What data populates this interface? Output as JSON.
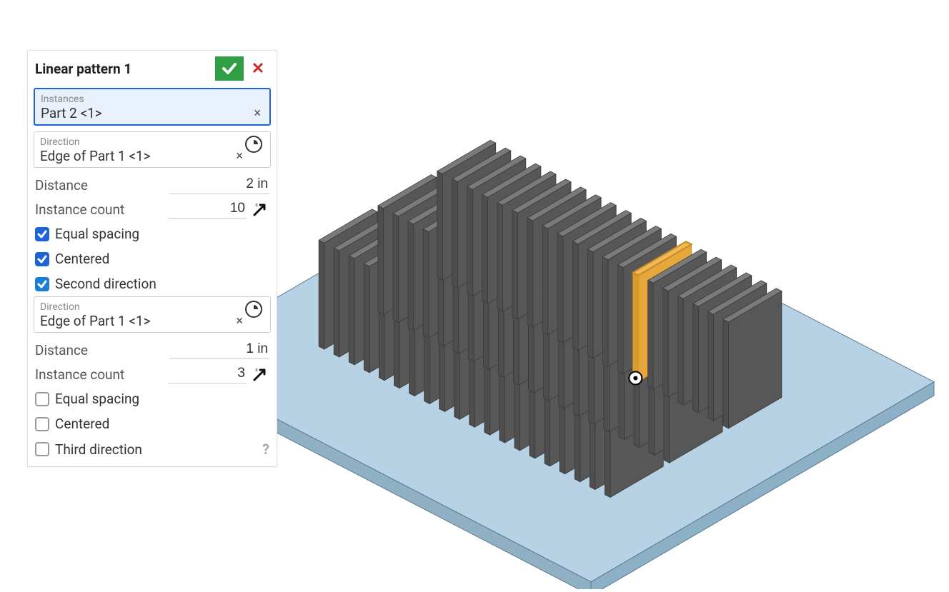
{
  "panel": {
    "title": "Linear pattern 1",
    "instances": {
      "label": "Instances",
      "value": "Part 2 <1>"
    },
    "direction1": {
      "label": "Direction",
      "value": "Edge of Part 1 <1>",
      "distance": "2 in",
      "count": "10",
      "equal_spacing": true,
      "centered": true
    },
    "second_direction_enabled": true,
    "direction2": {
      "label": "Direction",
      "value": "Edge of Part 1 <1>",
      "distance": "1 in",
      "count": "3",
      "equal_spacing": false,
      "centered": false
    },
    "third_direction_enabled": false,
    "labels": {
      "distance": "Distance",
      "instance_count": "Instance count",
      "equal_spacing": "Equal spacing",
      "centered": "Centered",
      "second_direction": "Second direction",
      "third_direction": "Third direction"
    }
  },
  "model": {
    "base_color_top": "#b7d2e5",
    "base_color_side": "#90b0c3",
    "fin_color_top": "#6b6b6b",
    "fin_color_side": "#575757",
    "seed_color_fill": "#e6a83a",
    "seed_color_outline": "#c78a1f",
    "fin_rows": 3,
    "fin_cols": 20
  }
}
